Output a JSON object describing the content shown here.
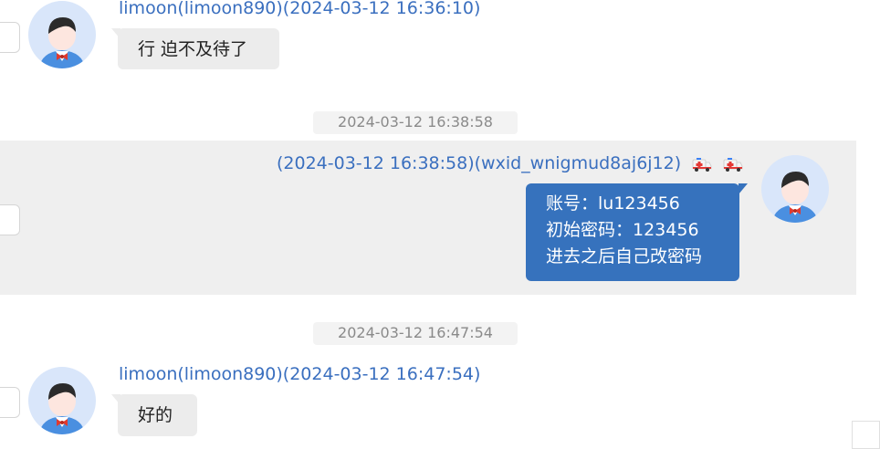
{
  "messages": [
    {
      "sender": "limoon(limoon890)(2024-03-12 16:36:10)",
      "text": "行 迫不及待了"
    },
    {
      "separator": "2024-03-12 16:38:58"
    },
    {
      "sender": "(2024-03-12 16:38:58)(wxid_wnigmud8aj6j12)",
      "icons": [
        "ambulance-icon",
        "ambulance-icon"
      ],
      "lines": [
        "账号：lu123456",
        "初始密码：123456",
        "进去之后自己改密码"
      ]
    },
    {
      "separator": "2024-03-12 16:47:54"
    },
    {
      "sender": "limoon(limoon890)(2024-03-12 16:47:54)",
      "text": "好的"
    }
  ],
  "colors": {
    "sender_text": "#3a6fbf",
    "outgoing_bubble": "#3672bd",
    "incoming_bubble": "#ececec",
    "highlight_band": "#efefef",
    "avatar_bg": "#d9e6fa"
  }
}
